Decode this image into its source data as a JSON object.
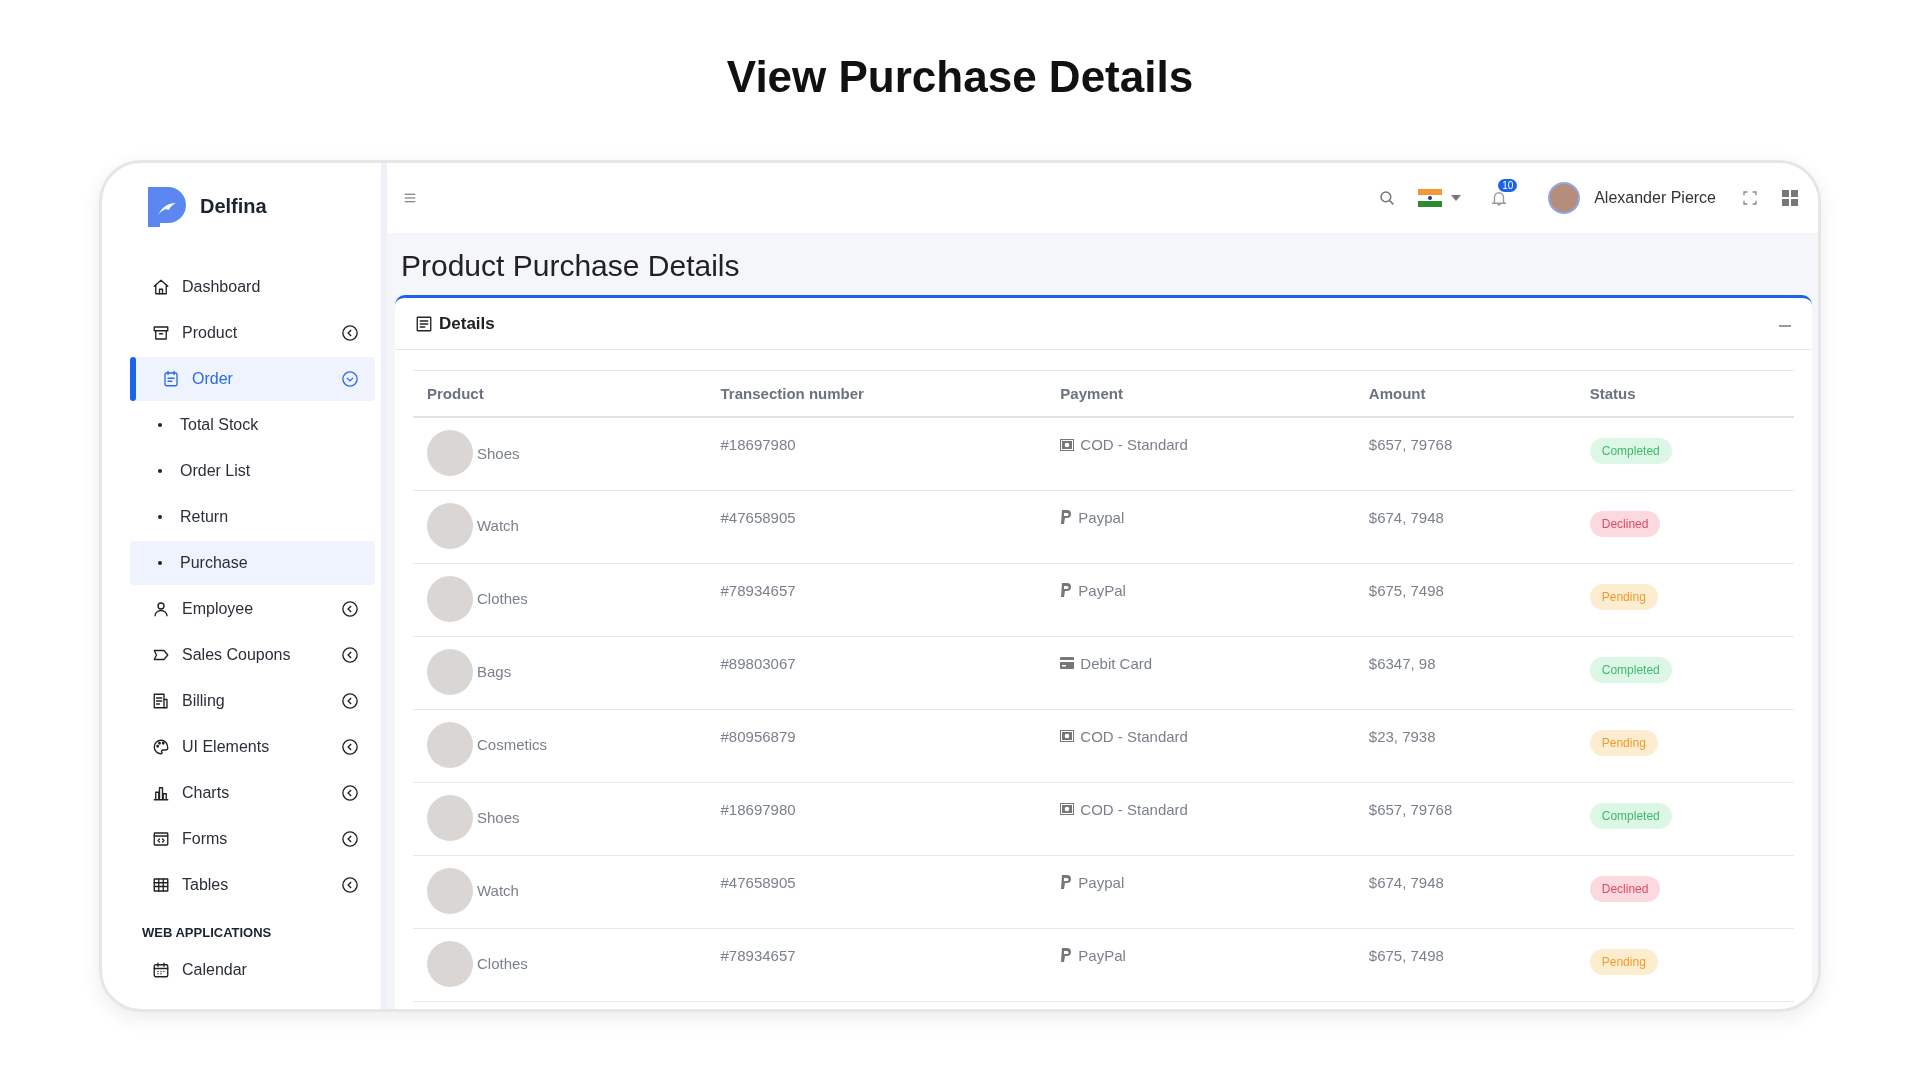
{
  "page_heading": "View Purchase Details",
  "sidebar": {
    "brand": "Delfina",
    "items": [
      {
        "label": "Dashboard",
        "selected": false
      },
      {
        "label": "Product",
        "selected": false,
        "expanded": false
      },
      {
        "label": "Order",
        "selected": true,
        "expanded": true,
        "children": [
          {
            "label": "Total Stock",
            "selected": false
          },
          {
            "label": "Order List",
            "selected": false
          },
          {
            "label": "Return",
            "selected": false
          },
          {
            "label": "Purchase",
            "selected": true
          }
        ]
      },
      {
        "label": "Employee",
        "selected": false,
        "expanded": false
      },
      {
        "label": "Sales Coupons",
        "selected": false,
        "expanded": false
      },
      {
        "label": "Billing",
        "selected": false,
        "expanded": false
      },
      {
        "label": "UI Elements",
        "selected": false,
        "expanded": false
      },
      {
        "label": "Charts",
        "selected": false,
        "expanded": false
      },
      {
        "label": "Forms",
        "selected": false,
        "expanded": false
      },
      {
        "label": "Tables",
        "selected": false,
        "expanded": false
      }
    ],
    "section": "WEB APPLICATIONS",
    "section_items": [
      {
        "label": "Calendar",
        "selected": false
      }
    ]
  },
  "topbar": {
    "notification_count": "10",
    "user_name": "Alexander Pierce"
  },
  "page_title": "Product Purchase Details",
  "card": {
    "title": "Details",
    "table": {
      "columns": [
        "Product",
        "Transection number",
        "Payment",
        "Amount",
        "Status"
      ],
      "rows": [
        {
          "product": "Shoes",
          "number": "#18697980",
          "payment": {
            "kind": "cash",
            "label": "COD - Standard"
          },
          "amount": "$657, 79768",
          "status": {
            "kind": "success",
            "label": "Completed"
          }
        },
        {
          "product": "Watch",
          "number": "#47658905",
          "payment": {
            "kind": "paypal",
            "label": "Paypal"
          },
          "amount": "$674, 7948",
          "status": {
            "kind": "danger",
            "label": "Declined"
          }
        },
        {
          "product": "Clothes",
          "number": "#78934657",
          "payment": {
            "kind": "paypal",
            "label": "PayPal"
          },
          "amount": "$675, 7498",
          "status": {
            "kind": "warning",
            "label": "Pending"
          }
        },
        {
          "product": "Bags",
          "number": "#89803067",
          "payment": {
            "kind": "card",
            "label": "Debit Card"
          },
          "amount": "$6347, 98",
          "status": {
            "kind": "success",
            "label": "Completed"
          }
        },
        {
          "product": "Cosmetics",
          "number": "#80956879",
          "payment": {
            "kind": "cash",
            "label": "COD - Standard"
          },
          "amount": "$23, 7938",
          "status": {
            "kind": "warning",
            "label": "Pending"
          }
        },
        {
          "product": "Shoes",
          "number": "#18697980",
          "payment": {
            "kind": "cash",
            "label": "COD - Standard"
          },
          "amount": "$657, 79768",
          "status": {
            "kind": "success",
            "label": "Completed"
          }
        },
        {
          "product": "Watch",
          "number": "#47658905",
          "payment": {
            "kind": "paypal",
            "label": "Paypal"
          },
          "amount": "$674, 7948",
          "status": {
            "kind": "danger",
            "label": "Declined"
          }
        },
        {
          "product": "Clothes",
          "number": "#78934657",
          "payment": {
            "kind": "paypal",
            "label": "PayPal"
          },
          "amount": "$675, 7498",
          "status": {
            "kind": "warning",
            "label": "Pending"
          }
        }
      ]
    }
  }
}
